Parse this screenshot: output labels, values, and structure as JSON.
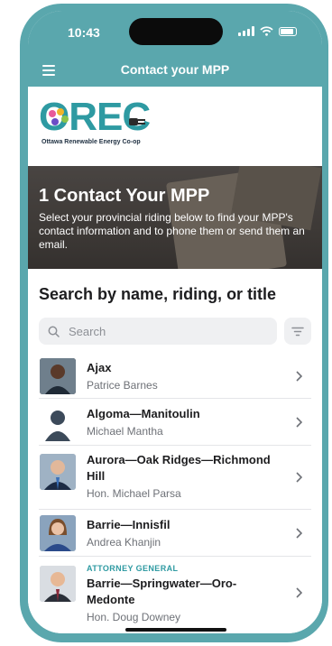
{
  "status_bar": {
    "time": "10:43"
  },
  "header": {
    "title": "Contact your MPP"
  },
  "logo": {
    "word": "OREC",
    "subtitle": "Ottawa Renewable Energy Co-op"
  },
  "hero": {
    "title": "1 Contact Your MPP",
    "description": "Select your provincial riding below to find your MPP's contact information and to phone them or send them an email."
  },
  "search": {
    "title": "Search by name, riding, or title",
    "placeholder": "Search"
  },
  "mpps": [
    {
      "riding": "Ajax",
      "name": "Patrice Barnes",
      "badge": ""
    },
    {
      "riding": "Algoma—Manitoulin",
      "name": "Michael Mantha",
      "badge": ""
    },
    {
      "riding": "Aurora—Oak Ridges—Richmond Hill",
      "name": "Hon. Michael Parsa",
      "badge": ""
    },
    {
      "riding": "Barrie—Innisfil",
      "name": "Andrea Khanjin",
      "badge": ""
    },
    {
      "riding": "Barrie—Springwater—Oro-Medonte",
      "name": "Hon. Doug Downey",
      "badge": "ATTORNEY GENERAL"
    }
  ],
  "colors": {
    "brand": "#5aa7ad",
    "accent": "#2e9aa2"
  },
  "icons": {
    "menu": "hamburger-icon",
    "search": "search-icon",
    "filter": "filter-icon",
    "chevron": "chevron-right-icon"
  }
}
